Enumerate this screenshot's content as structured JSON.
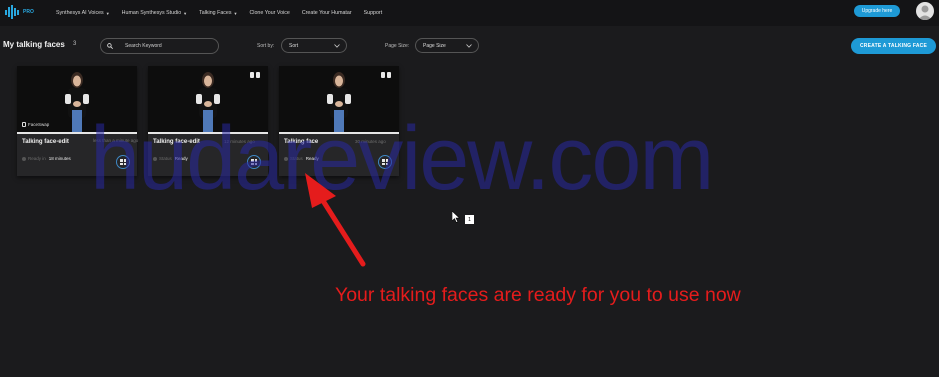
{
  "brand": {
    "badge": "PRO",
    "accent": "#1e9ad6"
  },
  "nav": {
    "items": [
      {
        "label": "Synthesys AI Voices",
        "dropdown": true
      },
      {
        "label": "Human Synthesys Studio",
        "dropdown": true
      },
      {
        "label": "Talking Faces",
        "dropdown": true
      },
      {
        "label": "Clone Your Voice",
        "dropdown": false
      },
      {
        "label": "Create Your Humatar",
        "dropdown": false
      },
      {
        "label": "Support",
        "dropdown": false
      }
    ],
    "upgrade_label": "Upgrade here"
  },
  "toolbar": {
    "title": "My talking faces",
    "count": "3",
    "search_placeholder": "Search Keyword",
    "sort_label": "Sort by:",
    "sort_value": "Sort",
    "page_size_label": "Page Size:",
    "page_size_value": "Page Size",
    "create_label": "CREATE A TALKING FACE"
  },
  "cards": [
    {
      "title": "Talking face-edit",
      "time": "less than a minute ago",
      "status_key": "Ready in",
      "status_value": "18 minutes",
      "badge": "FaceSwap"
    },
    {
      "title": "Talking face-edit",
      "time": "12 minutes ago",
      "status_key": "Status",
      "status_value": "Ready"
    },
    {
      "title": "Talking face",
      "time": "30 minutes ago",
      "status_key": "Status",
      "status_value": "Ready"
    }
  ],
  "watermark": "hudareview.com",
  "annotation": {
    "caption": "Your talking faces are ready for you to use now",
    "color": "#e51c1c"
  },
  "cursor_badge": "1"
}
